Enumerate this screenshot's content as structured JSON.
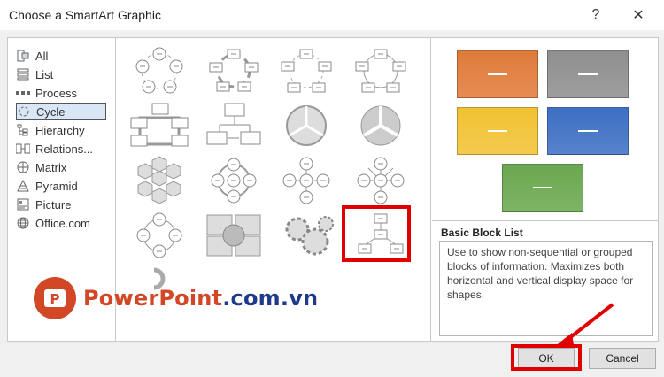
{
  "window": {
    "title": "Choose a SmartArt Graphic",
    "help_glyph": "?",
    "close_glyph": "✕"
  },
  "categories": [
    {
      "label": "All",
      "icon": "all-icon"
    },
    {
      "label": "List",
      "icon": "list-icon"
    },
    {
      "label": "Process",
      "icon": "process-icon"
    },
    {
      "label": "Cycle",
      "icon": "cycle-icon",
      "selected": true
    },
    {
      "label": "Hierarchy",
      "icon": "hierarchy-icon"
    },
    {
      "label": "Relations...",
      "icon": "relationship-icon"
    },
    {
      "label": "Matrix",
      "icon": "matrix-icon"
    },
    {
      "label": "Pyramid",
      "icon": "pyramid-icon"
    },
    {
      "label": "Picture",
      "icon": "picture-icon"
    },
    {
      "label": "Office.com",
      "icon": "globe-icon"
    }
  ],
  "layouts": [
    {
      "icon": "basic-cycle-icon"
    },
    {
      "icon": "text-cycle-icon"
    },
    {
      "icon": "block-cycle-icon"
    },
    {
      "icon": "nondirectional-cycle-icon"
    },
    {
      "icon": "continuous-cycle-icon"
    },
    {
      "icon": "segmented-cycle-icon"
    },
    {
      "icon": "basic-pie-icon"
    },
    {
      "icon": "pie-cycle-icon"
    },
    {
      "icon": "hexagon-radial-icon"
    },
    {
      "icon": "radial-cycle-icon"
    },
    {
      "icon": "basic-radial-icon"
    },
    {
      "icon": "diverging-radial-icon"
    },
    {
      "icon": "radial-venn-icon"
    },
    {
      "icon": "cycle-matrix-icon"
    },
    {
      "icon": "gear-icon"
    },
    {
      "icon": "basic-block-list-icon",
      "selected": true
    },
    {
      "icon": "circle-arrow-process-icon"
    }
  ],
  "preview": {
    "name": "Basic Block List",
    "description": "Use to show non-sequential or grouped blocks of information. Maximizes both horizontal and vertical display space for shapes.",
    "colors": [
      "#e07b39",
      "#8f8f8f",
      "#f1c232",
      "#3d6fc4",
      "#6aa84f"
    ]
  },
  "buttons": {
    "ok": "OK",
    "cancel": "Cancel"
  },
  "watermark": {
    "brand": "PowerPoint",
    "domain": ".com.vn",
    "logo_letter": "P",
    "accent": "#d24726",
    "highlight": "#e00000"
  }
}
